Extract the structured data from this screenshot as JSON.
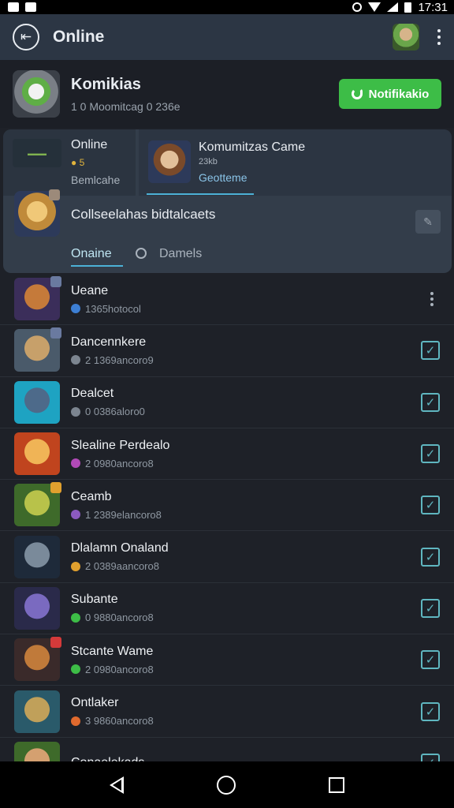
{
  "status_bar": {
    "time": "17:31"
  },
  "app_bar": {
    "title": "Online"
  },
  "profile": {
    "name": "Komikias",
    "subtitle": "1 0 Moomitcag 0 236e",
    "button_label": "Notifikakio"
  },
  "card": {
    "left_title": "Online",
    "left_coins": "● 5",
    "left_sub": "Bemlcahe",
    "game_title": "Komumitzas Came",
    "game_level": "23kb",
    "game_tag": "Geotteme",
    "mid_title": "Collseelahas bidtalcaets",
    "tab_online": "Onaine",
    "tab_games": "Damels"
  },
  "games": [
    {
      "title": "Ueane",
      "sub": "1365hotocol",
      "dot": "#3d7fd4",
      "action": "menu",
      "img": [
        "#c57a3a",
        "#3b2e5a"
      ]
    },
    {
      "title": "Dancennkere",
      "sub": "2 1369ancoro9",
      "dot": "#7c8590",
      "action": "check",
      "img": [
        "#c7a06a",
        "#4a5a6a"
      ]
    },
    {
      "title": "Dealcet",
      "sub": "0 0386aloro0",
      "dot": "#7c8590",
      "action": "check",
      "img": [
        "#4d6a8a",
        "#1ea3c2"
      ]
    },
    {
      "title": "Slealine Perdealo",
      "sub": "2 0980ancoro8",
      "dot": "#b24ab8",
      "action": "check",
      "img": [
        "#f0b456",
        "#c0441e"
      ]
    },
    {
      "title": "Ceamb",
      "sub": "1 2389elancoro8",
      "dot": "#8b5ac0",
      "action": "check",
      "img": [
        "#b8c24a",
        "#3e6a2a"
      ]
    },
    {
      "title": "Dlalamn Onaland",
      "sub": "2 0389aancoro8",
      "dot": "#e0a02e",
      "action": "check",
      "img": [
        "#7a8a9a",
        "#1e2a3a"
      ]
    },
    {
      "title": "Subante",
      "sub": "0 9880ancoro8",
      "dot": "#3dbd47",
      "action": "check",
      "img": [
        "#7a6ac0",
        "#2a2a4a"
      ]
    },
    {
      "title": "Stcante Wame",
      "sub": "2 0980ancoro8",
      "dot": "#3dbd47",
      "action": "check",
      "img": [
        "#c07a3a",
        "#3a2a2a"
      ]
    },
    {
      "title": "Ontlaker",
      "sub": "3 9860ancoro8",
      "dot": "#e06a2e",
      "action": "check",
      "img": [
        "#c0a05a",
        "#2a5a6a"
      ]
    },
    {
      "title": "Conaelekads",
      "sub": "",
      "dot": "#3dbd47",
      "action": "check",
      "img": [
        "#d4a070",
        "#3e6a2a"
      ]
    }
  ]
}
